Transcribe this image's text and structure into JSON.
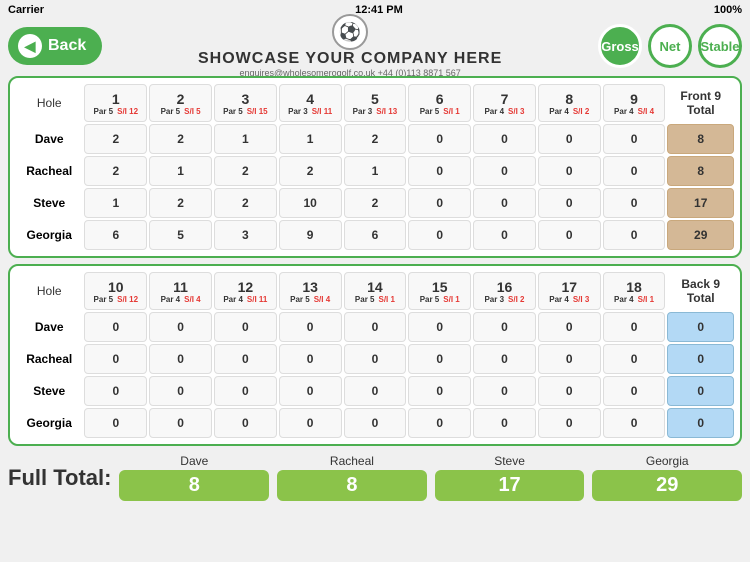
{
  "statusBar": {
    "carrier": "Carrier",
    "wifi": "WiFi",
    "time": "12:41 PM",
    "battery": "100%"
  },
  "header": {
    "backLabel": "Back",
    "companyName": "SHOWCASE YOUR COMPANY HERE",
    "companySub": "enquires@wholesomerogolf.co.uk  +44 (0)113 8871 567",
    "btnGross": "Gross",
    "btnNet": "Net",
    "btnStable": "Stable"
  },
  "front9": {
    "sectionTitle": "Front 9\nTotal",
    "holes": [
      {
        "num": "1",
        "par": "5",
        "si": "12"
      },
      {
        "num": "2",
        "par": "5",
        "si": "5"
      },
      {
        "num": "3",
        "par": "5",
        "si": "15"
      },
      {
        "num": "4",
        "par": "3",
        "si": "11"
      },
      {
        "num": "5",
        "par": "3",
        "si": "13"
      },
      {
        "num": "6",
        "par": "5",
        "si": "1"
      },
      {
        "num": "7",
        "par": "4",
        "si": "3"
      },
      {
        "num": "8",
        "par": "4",
        "si": "2"
      },
      {
        "num": "9",
        "par": "4",
        "si": "4"
      }
    ],
    "players": [
      {
        "name": "Dave",
        "scores": [
          2,
          2,
          1,
          1,
          2,
          0,
          0,
          0,
          0
        ],
        "total": 8
      },
      {
        "name": "Racheal",
        "scores": [
          2,
          1,
          2,
          2,
          1,
          0,
          0,
          0,
          0
        ],
        "total": 8
      },
      {
        "name": "Steve",
        "scores": [
          1,
          2,
          2,
          10,
          2,
          0,
          0,
          0,
          0
        ],
        "total": 17
      },
      {
        "name": "Georgia",
        "scores": [
          6,
          5,
          3,
          9,
          6,
          0,
          0,
          0,
          0
        ],
        "total": 29
      }
    ]
  },
  "back9": {
    "sectionTitle": "Back 9\nTotal",
    "holes": [
      {
        "num": "10",
        "par": "5",
        "si": "12"
      },
      {
        "num": "11",
        "par": "4",
        "si": "4"
      },
      {
        "num": "12",
        "par": "4",
        "si": "11"
      },
      {
        "num": "13",
        "par": "5",
        "si": "4"
      },
      {
        "num": "14",
        "par": "5",
        "si": "1"
      },
      {
        "num": "15",
        "par": "5",
        "si": "1"
      },
      {
        "num": "16",
        "par": "3",
        "si": "2"
      },
      {
        "num": "17",
        "par": "4",
        "si": "3"
      },
      {
        "num": "18",
        "par": "4",
        "si": "1"
      }
    ],
    "players": [
      {
        "name": "Dave",
        "scores": [
          0,
          0,
          0,
          0,
          0,
          0,
          0,
          0,
          0
        ],
        "total": 0
      },
      {
        "name": "Racheal",
        "scores": [
          0,
          0,
          0,
          0,
          0,
          0,
          0,
          0,
          0
        ],
        "total": 0
      },
      {
        "name": "Steve",
        "scores": [
          0,
          0,
          0,
          0,
          0,
          0,
          0,
          0,
          0
        ],
        "total": 0
      },
      {
        "name": "Georgia",
        "scores": [
          0,
          0,
          0,
          0,
          0,
          0,
          0,
          0,
          0
        ],
        "total": 0
      }
    ]
  },
  "fullTotal": {
    "label": "Full Total:",
    "players": [
      {
        "name": "Dave",
        "total": 8
      },
      {
        "name": "Racheal",
        "total": 8
      },
      {
        "name": "Steve",
        "total": 17
      },
      {
        "name": "Georgia",
        "total": 29
      }
    ]
  }
}
